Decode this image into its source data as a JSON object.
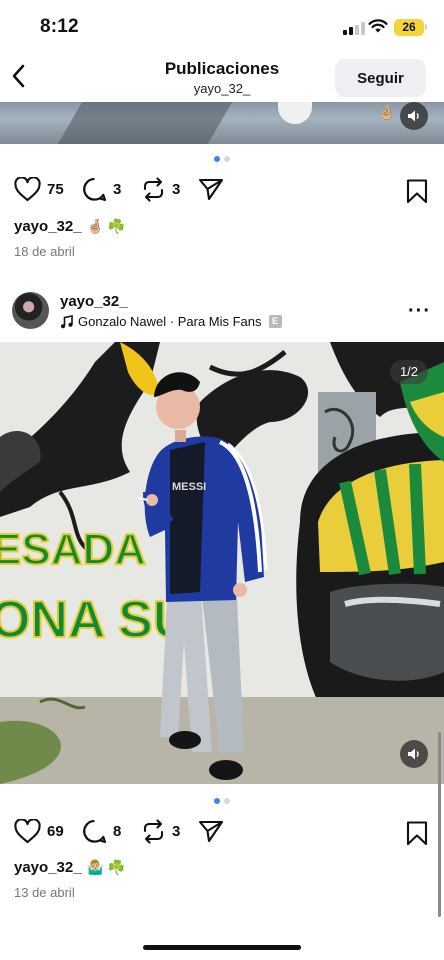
{
  "status_bar": {
    "time": "8:12",
    "battery": "26"
  },
  "header": {
    "title": "Publicaciones",
    "subtitle": "yayo_32_",
    "follow_label": "Seguir"
  },
  "post1": {
    "likes": "75",
    "comments": "3",
    "reposts": "3",
    "caption_user": "yayo_32_",
    "caption_emoji": "🤞🏼 ☘️",
    "date": "18 de abril"
  },
  "post2": {
    "username": "yayo_32_",
    "music": "Gonzalo Nawel · Para Mis Fans",
    "explicit": "E",
    "carousel_counter": "1/2",
    "mural_text_1": "ESADA",
    "mural_text_2": "ONA SU",
    "jersey_text": "MESSI",
    "likes": "69",
    "comments": "8",
    "reposts": "3",
    "caption_user": "yayo_32_",
    "caption_emoji": "🤷🏼‍♂️ ☘️",
    "date": "13 de abril"
  },
  "colors": {
    "accent_dot": "#3b82f6",
    "follow_bg": "#eeeff2",
    "battery": "#f3d43a"
  },
  "icons": [
    "back-chevron-icon",
    "heart-icon",
    "comment-icon",
    "repost-icon",
    "share-icon",
    "bookmark-icon",
    "music-note-icon",
    "volume-icon",
    "more-icon"
  ]
}
